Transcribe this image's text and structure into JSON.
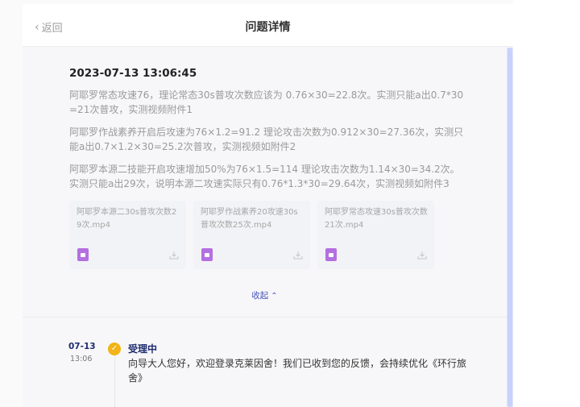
{
  "header": {
    "back_label": "返回",
    "title": "问题详情"
  },
  "report": {
    "datetime": "2023-07-13 13:06:45",
    "paragraphs": [
      "阿耶罗常态攻速76，理论常态30s普攻次数应该为 0.76×30=22.8次。实测只能a出0.7*30=21次普攻，实测视频附件1",
      "阿耶罗作战素养开启后攻速为76×1.2=91.2 理论攻击次数为0.912×30=27.36次，实测只能a出0.7×1.2×30=25.2次普攻，实测视频如附件2",
      "阿耶罗本源二技能开启攻速增加50%为76×1.5=114 理论攻击次数为1.14×30=34.2次。实测只能a出29次，说明本源二攻速实际只有0.76*1.3*30=29.64次，实测视频如附件3"
    ],
    "attachments": [
      {
        "name": "阿耶罗本源二30s普攻次数29次.mp4"
      },
      {
        "name": "阿耶罗作战素养20攻速30s普攻次数25次.mp4"
      },
      {
        "name": "阿耶罗常态攻速30s普攻次数21次.mp4"
      }
    ],
    "collapse_label": "收起"
  },
  "timeline": {
    "date": "07-13",
    "time": "13:06",
    "status": "受理中",
    "message": "向导大人您好，欢迎登录克莱因舍！我们已收到您的反馈，会持续优化《环行旅舍》"
  },
  "colors": {
    "accent_navy": "#1d2b6e",
    "link_blue": "#4a56b8",
    "status_yellow": "#f2b416",
    "file_icon_purple": "#b46fe0"
  },
  "icons": {
    "back": "chevron-left-icon",
    "file": "video-file-icon",
    "download": "download-icon",
    "collapse": "chevron-up-icon",
    "status": "check-circle-icon"
  }
}
